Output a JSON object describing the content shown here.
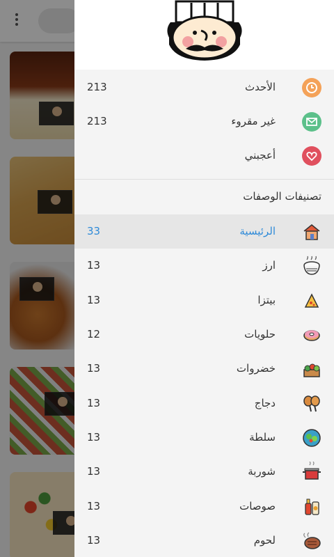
{
  "drawer": {
    "quick_items": [
      {
        "label": "الأحدث",
        "count": "213",
        "icon": "clock-icon"
      },
      {
        "label": "غير مقروء",
        "count": "213",
        "icon": "envelope-icon"
      },
      {
        "label": "أعجبني",
        "count": "",
        "icon": "heart-icon"
      }
    ],
    "section_title": "تصنيفات الوصفات",
    "categories": [
      {
        "label": "الرئيسية",
        "count": "33",
        "icon": "home-icon",
        "active": true
      },
      {
        "label": "ارز",
        "count": "13",
        "icon": "rice-bowl-icon"
      },
      {
        "label": "بيتزا",
        "count": "13",
        "icon": "pizza-icon"
      },
      {
        "label": "حلويات",
        "count": "12",
        "icon": "donut-icon"
      },
      {
        "label": "خضروات",
        "count": "13",
        "icon": "vegetables-icon"
      },
      {
        "label": "دجاج",
        "count": "13",
        "icon": "chicken-leg-icon"
      },
      {
        "label": "سلطة",
        "count": "13",
        "icon": "salad-icon"
      },
      {
        "label": "شوربة",
        "count": "13",
        "icon": "soup-pot-icon"
      },
      {
        "label": "صوصات",
        "count": "13",
        "icon": "sauce-bottles-icon"
      },
      {
        "label": "لحوم",
        "count": "13",
        "icon": "steak-icon"
      }
    ]
  },
  "colors": {
    "accent": "#2e8ad8",
    "clock": "#f4a259",
    "envelope": "#5cc08a",
    "heart": "#e0505e"
  }
}
